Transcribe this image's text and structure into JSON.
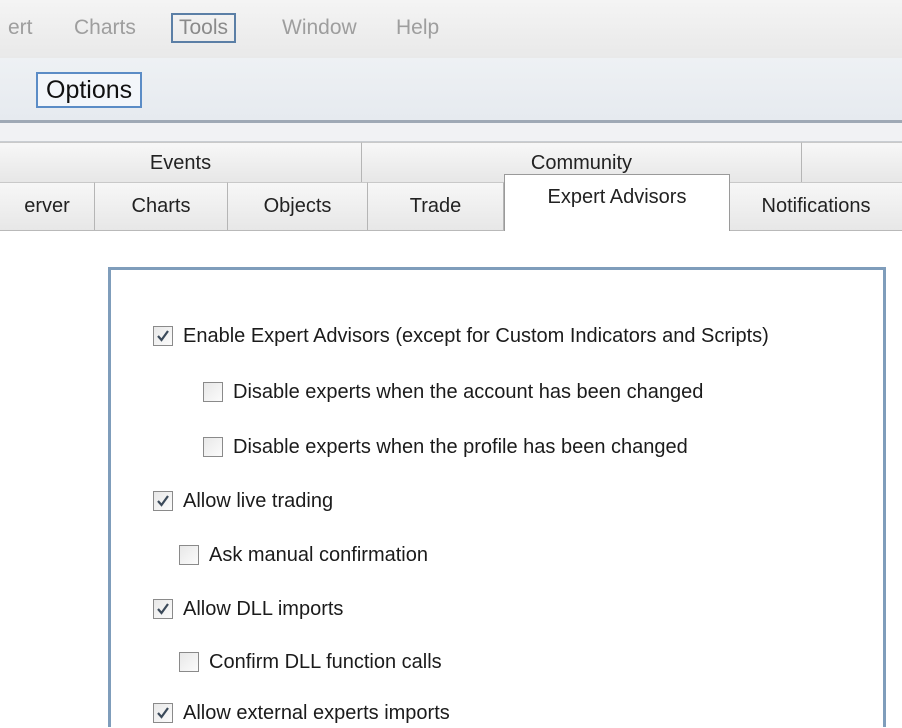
{
  "menubar": {
    "items": [
      "ert",
      "Charts",
      "Tools",
      "Window",
      "Help"
    ],
    "active_index": 2
  },
  "dialog": {
    "title": "Options"
  },
  "tabs": {
    "row1": [
      "Events",
      "Community",
      ""
    ],
    "row2": [
      "erver",
      "Charts",
      "Objects",
      "Trade",
      "Expert Advisors",
      "Notifications"
    ],
    "selected": "Expert Advisors"
  },
  "options": [
    {
      "label": "Enable Expert Advisors (except for Custom Indicators and Scripts)",
      "checked": true,
      "indent": 0
    },
    {
      "label": "Disable experts when the account has been changed",
      "checked": false,
      "indent": 1
    },
    {
      "label": "Disable experts when the profile has been changed",
      "checked": false,
      "indent": 1
    },
    {
      "label": "Allow live trading",
      "checked": true,
      "indent": 0
    },
    {
      "label": "Ask manual confirmation",
      "checked": false,
      "indent": 1
    },
    {
      "label": "Allow DLL imports",
      "checked": true,
      "indent": 0
    },
    {
      "label": "Confirm DLL function calls",
      "checked": false,
      "indent": 1
    },
    {
      "label": "Allow external experts imports",
      "checked": true,
      "indent": 0
    }
  ],
  "colors": {
    "accent": "#5b8cc6",
    "check": "#3b4a5a"
  }
}
